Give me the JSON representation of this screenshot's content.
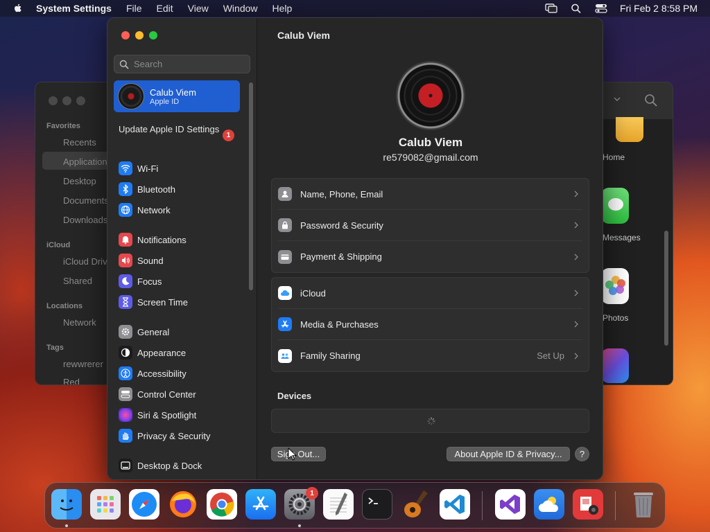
{
  "menubar": {
    "app_name": "System Settings",
    "menus": [
      "File",
      "Edit",
      "View",
      "Window",
      "Help"
    ],
    "datetime": "Fri Feb 2  8:58 PM"
  },
  "finder": {
    "sections": {
      "favorites": "Favorites",
      "icloud": "iCloud",
      "locations": "Locations",
      "tags": "Tags"
    },
    "favorites": [
      "Recents",
      "Applications",
      "Desktop",
      "Documents",
      "Downloads"
    ],
    "icloud_items": [
      "iCloud Drive",
      "Shared"
    ],
    "locations": [
      "Network"
    ],
    "tags": [
      "rewwrerer",
      "Red"
    ],
    "apps": [
      "Home",
      "Messages",
      "Photos"
    ]
  },
  "sidebar": {
    "search_placeholder": "Search",
    "profile": {
      "name": "Calub Viem",
      "subtitle": "Apple ID"
    },
    "update": {
      "label": "Update Apple ID Settings",
      "badge": "1"
    },
    "items": [
      {
        "label": "Wi-Fi",
        "icon": "wifi-icon",
        "color": "#1f7cf4"
      },
      {
        "label": "Bluetooth",
        "icon": "bluetooth-icon",
        "color": "#1f7cf4"
      },
      {
        "label": "Network",
        "icon": "globe-icon",
        "color": "#1f7cf4"
      },
      {
        "label": "Notifications",
        "icon": "bell-icon",
        "color": "#e5484d"
      },
      {
        "label": "Sound",
        "icon": "speaker-icon",
        "color": "#e5484d"
      },
      {
        "label": "Focus",
        "icon": "moon-icon",
        "color": "#5e5ce6"
      },
      {
        "label": "Screen Time",
        "icon": "hourglass-icon",
        "color": "#5e5ce6"
      },
      {
        "label": "General",
        "icon": "gear-icon",
        "color": "#8e8e93"
      },
      {
        "label": "Appearance",
        "icon": "appearance-icon",
        "color": "#1c1c1e"
      },
      {
        "label": "Accessibility",
        "icon": "accessibility-icon",
        "color": "#1f7cf4"
      },
      {
        "label": "Control Center",
        "icon": "control-center-icon",
        "color": "#8e8e93"
      },
      {
        "label": "Siri & Spotlight",
        "icon": "siri-icon",
        "color": "#b34fd6"
      },
      {
        "label": "Privacy & Security",
        "icon": "hand-icon",
        "color": "#1f7cf4"
      },
      {
        "label": "Desktop & Dock",
        "icon": "dock-icon",
        "color": "#1c1c1e"
      }
    ]
  },
  "main": {
    "title": "Calub Viem",
    "user_name": "Calub Viem",
    "email": "re579082@gmail.com",
    "group1": [
      {
        "label": "Name, Phone, Email",
        "icon": "contact-icon",
        "color": "#8e8e93"
      },
      {
        "label": "Password & Security",
        "icon": "lock-icon",
        "color": "#8e8e93"
      },
      {
        "label": "Payment & Shipping",
        "icon": "card-icon",
        "color": "#8e8e93"
      }
    ],
    "group2": [
      {
        "label": "iCloud",
        "icon": "icloud-icon",
        "color": "#ffffff",
        "value": ""
      },
      {
        "label": "Media & Purchases",
        "icon": "app-store-icon",
        "color": "#1f7cf4",
        "value": ""
      },
      {
        "label": "Family Sharing",
        "icon": "family-icon",
        "color": "#ffffff",
        "value": "Set Up"
      }
    ],
    "devices_heading": "Devices",
    "sign_out": "Sign Out...",
    "about": "About Apple ID & Privacy...",
    "help": "?"
  },
  "dock": {
    "apps": [
      "Finder",
      "Launchpad",
      "Safari",
      "Firefox",
      "Chrome",
      "App Store",
      "System Settings",
      "TextEdit",
      "Terminal",
      "GarageBand",
      "Visual Studio Code",
      "Visual Studio",
      "Weather",
      "Photo Booth",
      "Trash"
    ],
    "settings_badge": "1"
  }
}
